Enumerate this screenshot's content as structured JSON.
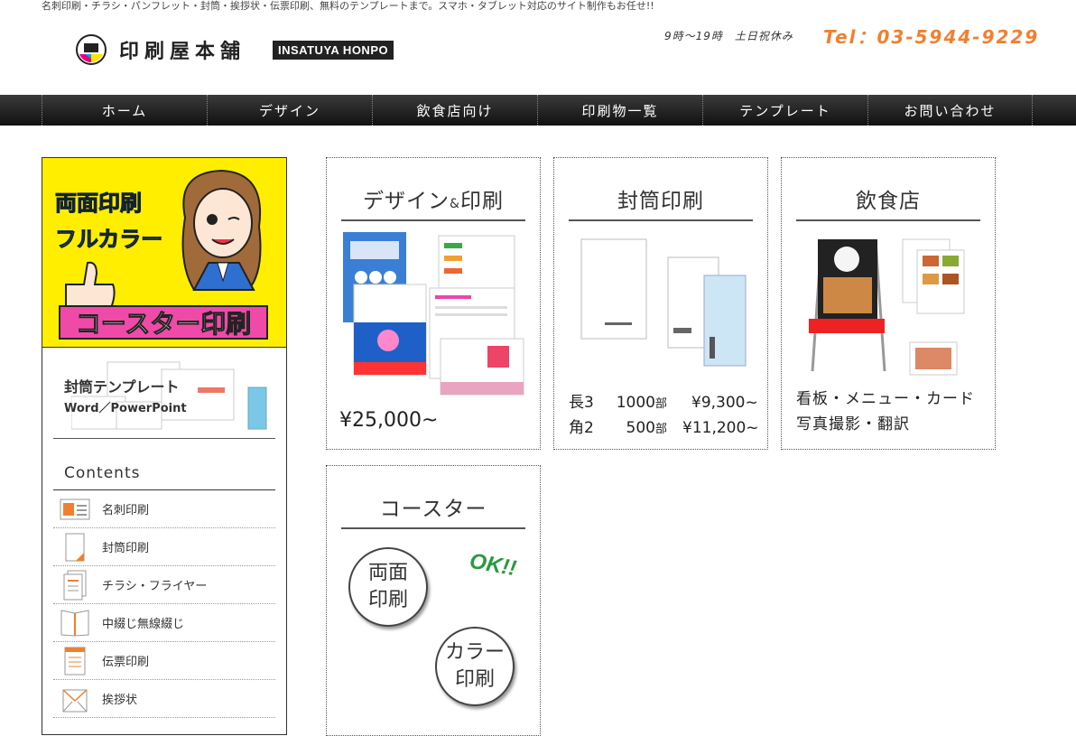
{
  "header": {
    "tagline": "名刺印刷・チラシ・パンフレット・封筒・挨拶状・伝票印刷、無料のテンプレートまで。スマホ・タブレット対応のサイト制作もお任せ!!",
    "logo_text": "印刷屋本舗",
    "logo_badge": "INSATUYA HONPO",
    "hours": "9時～19時　土日祝休み",
    "tel": "Tel：03-5944-9229"
  },
  "nav": [
    {
      "label": "ホーム"
    },
    {
      "label": "デザイン"
    },
    {
      "label": "飲食店向け"
    },
    {
      "label": "印刷物一覧"
    },
    {
      "label": "テンプレート"
    },
    {
      "label": "お問い合わせ"
    }
  ],
  "sidebar": {
    "banner": {
      "line1": "両面印刷",
      "line2": "フルカラー",
      "line3": "コースター印刷"
    },
    "envelope_template": {
      "title": "封筒テンプレート",
      "subtitle": "Word／PowerPoint"
    },
    "contents_title": "Contents",
    "items": [
      {
        "label": "名刺印刷",
        "icon": "business-card-icon"
      },
      {
        "label": "封筒印刷",
        "icon": "envelope-icon"
      },
      {
        "label": "チラシ・フライヤー",
        "icon": "flyer-icon"
      },
      {
        "label": "中綴じ無線綴じ",
        "icon": "booklet-icon"
      },
      {
        "label": "伝票印刷",
        "icon": "slip-icon"
      },
      {
        "label": "挨拶状",
        "icon": "greeting-card-icon"
      }
    ]
  },
  "cards": {
    "design": {
      "title": "デザイン",
      "amp": "&",
      "title2": "印刷",
      "price": "¥25,000~"
    },
    "envelope": {
      "title": "封筒印刷",
      "row1": {
        "size": "長3",
        "qty": "1000",
        "unit": "部",
        "price": "¥9,300~"
      },
      "row2": {
        "size": "角2",
        "qty": "500",
        "unit": "部",
        "price": "¥11,200~"
      }
    },
    "restaurant": {
      "title": "飲食店",
      "line1": "看板・メニュー・カード",
      "line2": "写真撮影・翻訳"
    },
    "coaster": {
      "title": "コースター",
      "circle1a": "両面",
      "circle1b": "印刷",
      "ok": "OK!!",
      "circle2a": "カラー",
      "circle2b": "印刷"
    }
  },
  "colors": {
    "accent": "#f08030",
    "nav_bg": "#222222",
    "banner_bg": "#ffee00",
    "banner_pink": "#f04aa8",
    "ok_green": "#2a9a40"
  }
}
